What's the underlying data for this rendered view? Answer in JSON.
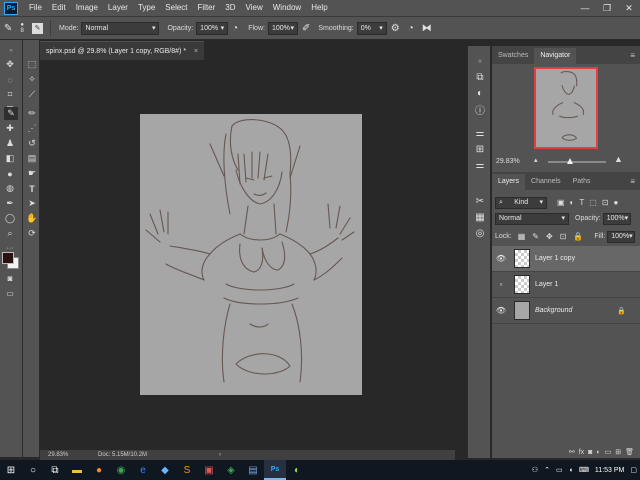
{
  "app": {
    "logo": "Ps",
    "menu": [
      "File",
      "Edit",
      "Image",
      "Layer",
      "Type",
      "Select",
      "Filter",
      "3D",
      "View",
      "Window",
      "Help"
    ],
    "window_controls": [
      "—",
      "❐",
      "✕"
    ]
  },
  "options_bar": {
    "brush_size": "8",
    "mode_label": "Mode:",
    "mode_value": "Normal",
    "opacity_label": "Opacity:",
    "opacity_value": "100%",
    "flow_label": "Flow:",
    "flow_value": "100%",
    "smoothing_label": "Smoothing:",
    "smoothing_value": "0%"
  },
  "document": {
    "tab_title": "spinx.psd @ 29.8% (Layer 1 copy, RGB/8#) *",
    "close": "×",
    "canvas_color": "#a6a6a6",
    "sketch_color": "#5b4a45"
  },
  "status_bar": {
    "zoom": "29.83%",
    "doc_info": "Doc: 5.15M/10.2M",
    "arrow": "›"
  },
  "colors": {
    "foreground": "#2b1210",
    "background": "#f2f2f2",
    "accent_red": "#e04040"
  },
  "navigator": {
    "tabs": [
      "Swatches",
      "Navigator"
    ],
    "active_tab": "Navigator",
    "zoom": "29.83%"
  },
  "layers_panel": {
    "tabs": [
      "Layers",
      "Channels",
      "Paths"
    ],
    "active_tab": "Layers",
    "filter_kind": "Kind",
    "blend_mode": "Normal",
    "opacity_label": "Opacity:",
    "opacity_value": "100%",
    "lock_label": "Lock:",
    "fill_label": "Fill:",
    "fill_value": "100%",
    "layers": [
      {
        "name": "Layer 1 copy",
        "visible": true,
        "selected": true,
        "type": "transparent"
      },
      {
        "name": "Layer 1",
        "visible": false,
        "selected": false,
        "type": "transparent"
      },
      {
        "name": "Background",
        "visible": true,
        "selected": false,
        "type": "background",
        "locked": true
      }
    ]
  },
  "taskbar": {
    "time": "11:53 PM"
  }
}
